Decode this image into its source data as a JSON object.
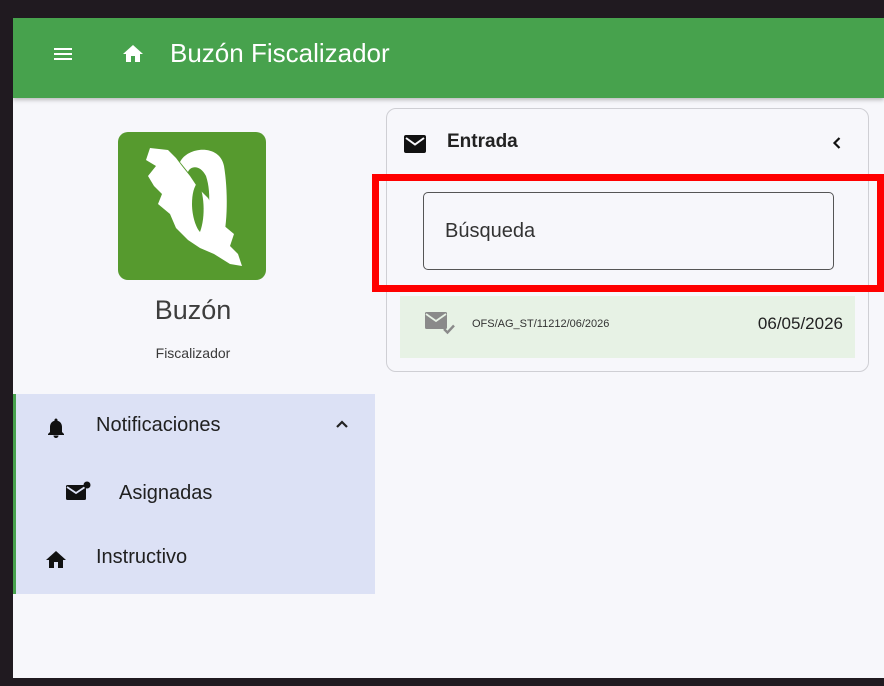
{
  "app": {
    "title": "Buzón Fiscalizador"
  },
  "brand": {
    "name": "Buzón",
    "subtitle": "Fiscalizador",
    "logo_color": "#569a2e"
  },
  "sidebar": {
    "items": [
      {
        "label": "Notificaciones",
        "icon": "bell-icon",
        "expanded": true
      },
      {
        "label": "Asignadas",
        "icon": "mail-badge-icon"
      },
      {
        "label": "Instructivo",
        "icon": "home-icon"
      }
    ]
  },
  "inbox": {
    "title": "Entrada",
    "search_placeholder": "Búsqueda",
    "messages": [
      {
        "code": "OFS/AG_ST/11212/06/2026",
        "date": "06/05/2026",
        "icon": "mail-check-icon"
      }
    ]
  },
  "colors": {
    "appbar": "#47a24d",
    "nav_bg": "#dce1f5",
    "row_bg": "#e7f2e5",
    "highlight": "#ff0000"
  }
}
